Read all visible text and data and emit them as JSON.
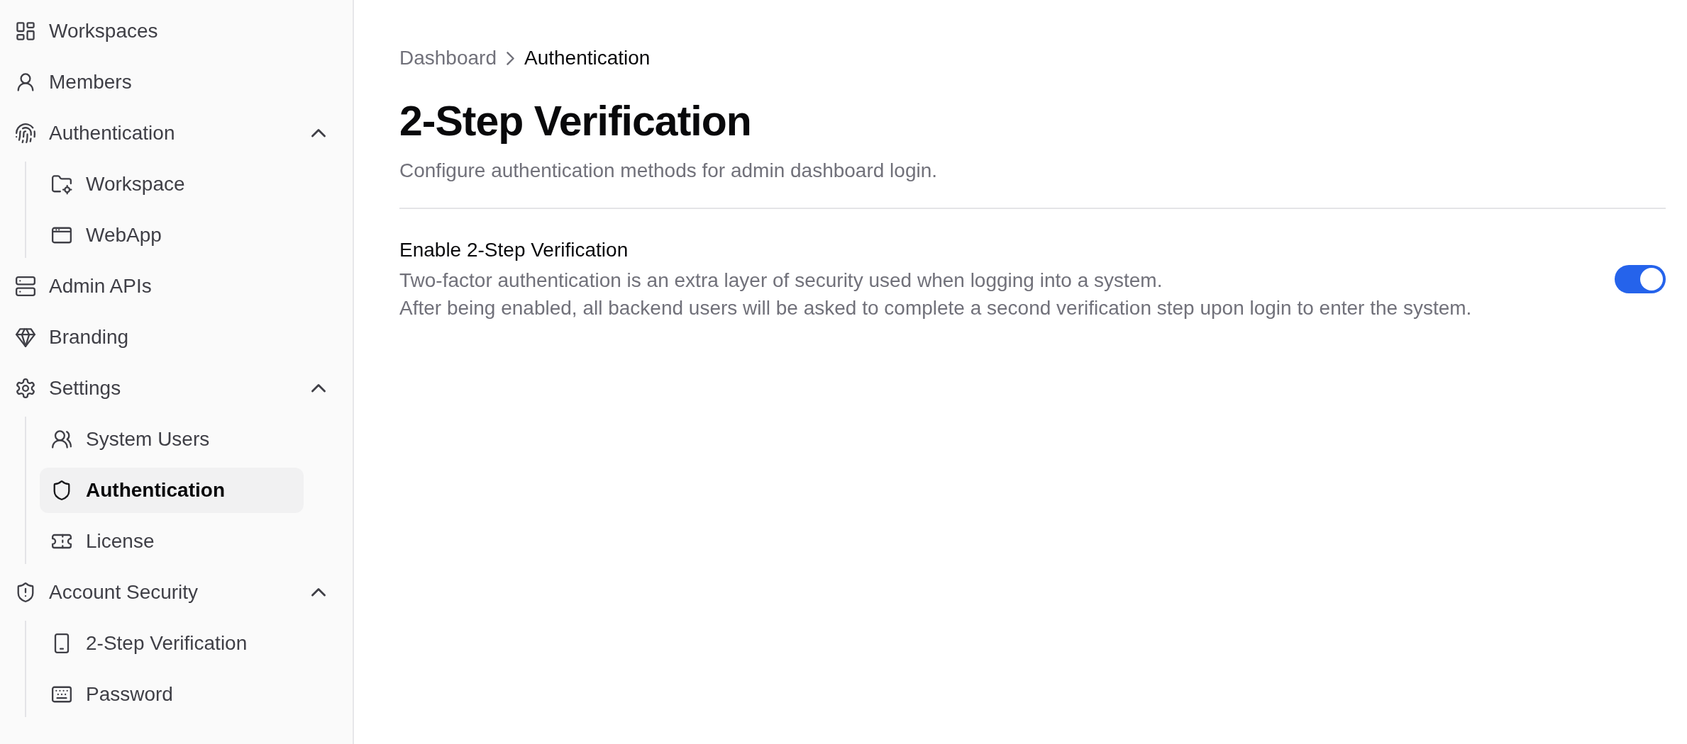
{
  "sidebar": {
    "items": [
      {
        "label": "Workspaces",
        "selected": false
      },
      {
        "label": "Members",
        "selected": false
      },
      {
        "label": "Authentication",
        "selected": false,
        "expanded": true,
        "children": [
          {
            "label": "Workspace",
            "selected": false
          },
          {
            "label": "WebApp",
            "selected": false
          }
        ]
      },
      {
        "label": "Admin APIs",
        "selected": false
      },
      {
        "label": "Branding",
        "selected": false
      },
      {
        "label": "Settings",
        "selected": false,
        "expanded": true,
        "children": [
          {
            "label": "System Users",
            "selected": false
          },
          {
            "label": "Authentication",
            "selected": true
          },
          {
            "label": "License",
            "selected": false
          }
        ]
      },
      {
        "label": "Account Security",
        "selected": false,
        "expanded": true,
        "children": [
          {
            "label": "2-Step Verification",
            "selected": false
          },
          {
            "label": "Password",
            "selected": false
          }
        ]
      }
    ]
  },
  "breadcrumb": [
    {
      "label": "Dashboard"
    },
    {
      "label": "Authentication"
    }
  ],
  "page": {
    "title": "2-Step Verification",
    "description": "Configure authentication methods for admin dashboard login."
  },
  "setting": {
    "title": "Enable 2-Step Verification",
    "description": [
      "Two-factor authentication is an extra layer of security used when logging into a system.",
      "After being enabled, all backend users will be asked to complete a second verification step upon login to enter the system."
    ],
    "on": true
  }
}
